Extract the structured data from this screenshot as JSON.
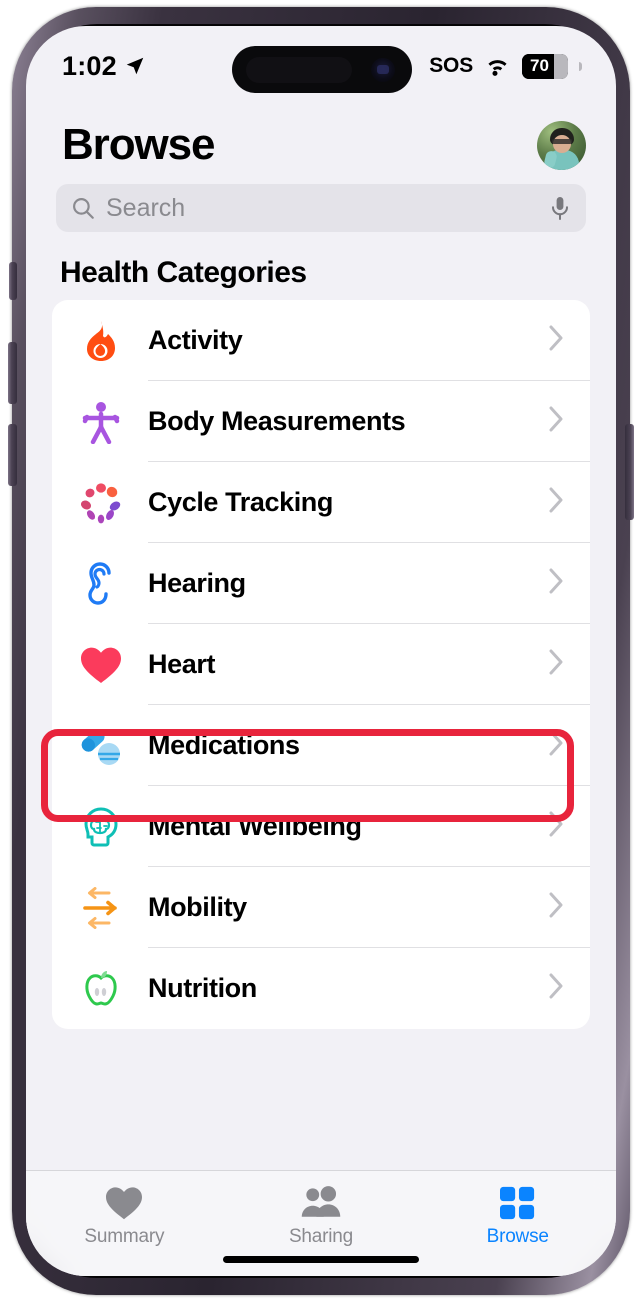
{
  "status_bar": {
    "time": "1:02",
    "location_icon": "location-arrow-icon",
    "sos_label": "SOS",
    "wifi_icon": "wifi-icon",
    "battery_percent": "70",
    "battery_level": 70
  },
  "header": {
    "title": "Browse",
    "avatar_name": "profile-avatar"
  },
  "search": {
    "placeholder": "Search",
    "value": "",
    "search_icon": "search-icon",
    "mic_icon": "microphone-icon"
  },
  "section": {
    "title": "Health Categories"
  },
  "categories": [
    {
      "label": "Activity",
      "icon": "flame-icon",
      "color": "#ff4d12"
    },
    {
      "label": "Body Measurements",
      "icon": "body-figure-icon",
      "color": "#a855e0"
    },
    {
      "label": "Cycle Tracking",
      "icon": "cycle-petals-icon",
      "color": "#e8476b"
    },
    {
      "label": "Hearing",
      "icon": "ear-icon",
      "color": "#1f7bf5"
    },
    {
      "label": "Heart",
      "icon": "heart-icon",
      "color": "#fb3b5c",
      "highlighted": true
    },
    {
      "label": "Medications",
      "icon": "pills-icon",
      "color": "#34a8e8"
    },
    {
      "label": "Mental Wellbeing",
      "icon": "brain-head-icon",
      "color": "#0fbfb5"
    },
    {
      "label": "Mobility",
      "icon": "arrows-icon",
      "color": "#f59415"
    },
    {
      "label": "Nutrition",
      "icon": "apple-icon",
      "color": "#2ec94d"
    }
  ],
  "tabs": [
    {
      "label": "Summary",
      "icon": "heart-icon",
      "active": false
    },
    {
      "label": "Sharing",
      "icon": "people-icon",
      "active": false
    },
    {
      "label": "Browse",
      "icon": "grid-icon",
      "active": true
    }
  ],
  "colors": {
    "accent": "#0a84ff",
    "highlight_annotation": "#e8243c",
    "background": "#f2f1f6",
    "card": "#ffffff",
    "inactive_tab": "#8a8a8f"
  }
}
